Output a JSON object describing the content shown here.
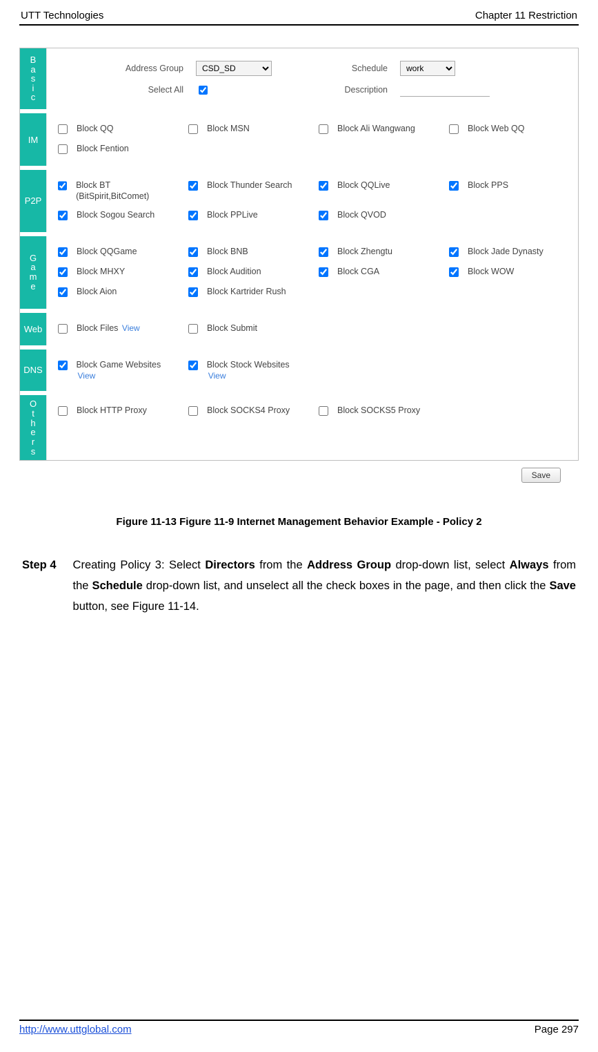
{
  "header": {
    "left": "UTT Technologies",
    "right": "Chapter 11 Restriction"
  },
  "footer": {
    "url": "http://www.uttglobal.com",
    "page": "Page 297"
  },
  "caption": "Figure 11-13 Figure 11-9 Internet Management Behavior Example - Policy 2",
  "step": {
    "num": "Step 4",
    "pre": "Creating Policy 3: Select ",
    "b1": "Directors",
    "mid1": " from the ",
    "b2": "Address Group",
    "mid2": " drop-down list, select ",
    "b3": "Always",
    "mid3": " from the ",
    "b4": "Schedule",
    "mid4": " drop-down list, and unselect all the check boxes in the page, and then click the ",
    "b5": "Save",
    "post": " button, see Figure 11-14."
  },
  "basic": {
    "addr_label": "Address Group",
    "addr_value": "CSD_SD",
    "sched_label": "Schedule",
    "sched_value": "work",
    "sel_all_label": "Select All",
    "sel_all_checked": true,
    "desc_label": "Description",
    "desc_value": ""
  },
  "sections": {
    "basic": "Basic",
    "im": "IM",
    "p2p": "P2P",
    "game": "Game",
    "web": "Web",
    "dns": "DNS",
    "others": "Others"
  },
  "im": [
    {
      "label": "Block QQ",
      "checked": false
    },
    {
      "label": "Block MSN",
      "checked": false
    },
    {
      "label": "Block Ali Wangwang",
      "checked": false
    },
    {
      "label": "Block Web QQ",
      "checked": false
    },
    {
      "label": "Block Fention",
      "checked": false
    }
  ],
  "p2p": [
    {
      "label": "Block BT (BitSpirit,BitComet)",
      "checked": true
    },
    {
      "label": "Block Thunder Search",
      "checked": true
    },
    {
      "label": "Block QQLive",
      "checked": true
    },
    {
      "label": "Block PPS",
      "checked": true
    },
    {
      "label": "Block Sogou Search",
      "checked": true
    },
    {
      "label": "Block PPLive",
      "checked": true
    },
    {
      "label": "Block QVOD",
      "checked": true
    }
  ],
  "game": [
    {
      "label": "Block QQGame",
      "checked": true
    },
    {
      "label": "Block BNB",
      "checked": true
    },
    {
      "label": "Block Zhengtu",
      "checked": true
    },
    {
      "label": "Block Jade Dynasty",
      "checked": true
    },
    {
      "label": "Block MHXY",
      "checked": true
    },
    {
      "label": "Block Audition",
      "checked": true
    },
    {
      "label": "Block CGA",
      "checked": true
    },
    {
      "label": "Block WOW",
      "checked": true
    },
    {
      "label": "Block Aion",
      "checked": true
    },
    {
      "label": "Block Kartrider Rush",
      "checked": true
    }
  ],
  "web": [
    {
      "label": "Block Files",
      "link": "View",
      "checked": false
    },
    {
      "label": "Block Submit",
      "checked": false
    }
  ],
  "dns": [
    {
      "label": "Block Game Websites",
      "link": "View",
      "checked": true
    },
    {
      "label": "Block Stock Websites",
      "link": "View",
      "checked": true
    }
  ],
  "others": [
    {
      "label": "Block HTTP Proxy",
      "checked": false
    },
    {
      "label": "Block SOCKS4 Proxy",
      "checked": false
    },
    {
      "label": "Block SOCKS5 Proxy",
      "checked": false
    }
  ],
  "save_label": "Save"
}
